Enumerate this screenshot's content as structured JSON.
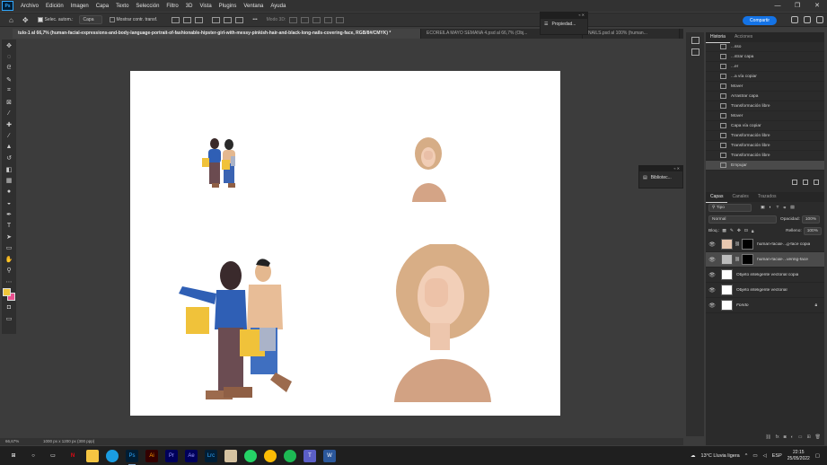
{
  "menubar": {
    "app_icon": "Ps",
    "items": [
      "Archivo",
      "Edición",
      "Imagen",
      "Capa",
      "Texto",
      "Selección",
      "Filtro",
      "3D",
      "Vista",
      "Plugins",
      "Ventana",
      "Ayuda"
    ],
    "window_controls": [
      "—",
      "❐",
      "✕"
    ]
  },
  "options": {
    "auto_select_label": "Selec. autom.:",
    "auto_select_value": "Capa",
    "show_transform_label": "Mostrar contr. transf.",
    "mode_3d_label": "Modo 3D:",
    "more": "•••",
    "share_label": "Compartir",
    "colors": {
      "share": "#1473e6"
    }
  },
  "tabs": [
    {
      "label": "tulo-1 al 66,7% (human-facial-expressions-and-body-language-portrait-of-fashionable-hipster-girl-with-messy-pinkish-hair-and-black-long-nails-covering-face, RGB/8#/CMYK) *",
      "close": "×"
    },
    {
      "label": "ECOREILA MAYO SEMANA 4.psd al 66,7% (Obj...",
      "close": "×"
    },
    {
      "label": "NAILS.psd al 100% (human...",
      "close": "×"
    }
  ],
  "properties_panel": {
    "title": "Propiedad..."
  },
  "libraries_panel": {
    "title": "Bibliotec..."
  },
  "statusbar": {
    "zoom": "66,67%",
    "doc_info": "1000 px x 1200 px (300 ppp)"
  },
  "history": {
    "tabs": [
      "Historia",
      "Acciones"
    ],
    "items": [
      "...sso",
      "...strar capa",
      "...er",
      "...a vía copiar",
      "Mover",
      "Arrastrar capa",
      "Transformación libre",
      "Mover",
      "Capa vía copiar",
      "Transformación libre",
      "Transformación libre",
      "Transformación libre",
      "Empujar"
    ]
  },
  "layers": {
    "tabs": [
      "Capas",
      "Canales",
      "Trazados"
    ],
    "filter_label": "Tipo",
    "blend_mode": "Normal",
    "opacity_label": "Opacidad:",
    "opacity_value": "100%",
    "lock_label": "Bloq.:",
    "fill_label": "Relleno:",
    "fill_value": "100%",
    "items": [
      {
        "name": "human-facial-...g-face copia",
        "selected": false,
        "mask": true
      },
      {
        "name": "human-facial-...vering-face",
        "selected": true,
        "mask": true
      },
      {
        "name": "Objeto inteligente vectorial copia",
        "selected": false,
        "mask": false
      },
      {
        "name": "Objeto inteligente vectorial",
        "selected": false,
        "mask": false
      },
      {
        "name": "Fondo",
        "selected": false,
        "mask": false,
        "locked": true
      }
    ]
  },
  "taskbar": {
    "weather": "13°C  Lluvia ligera",
    "lang": "ESP",
    "time": "22:15",
    "date": "25/05/2022"
  }
}
